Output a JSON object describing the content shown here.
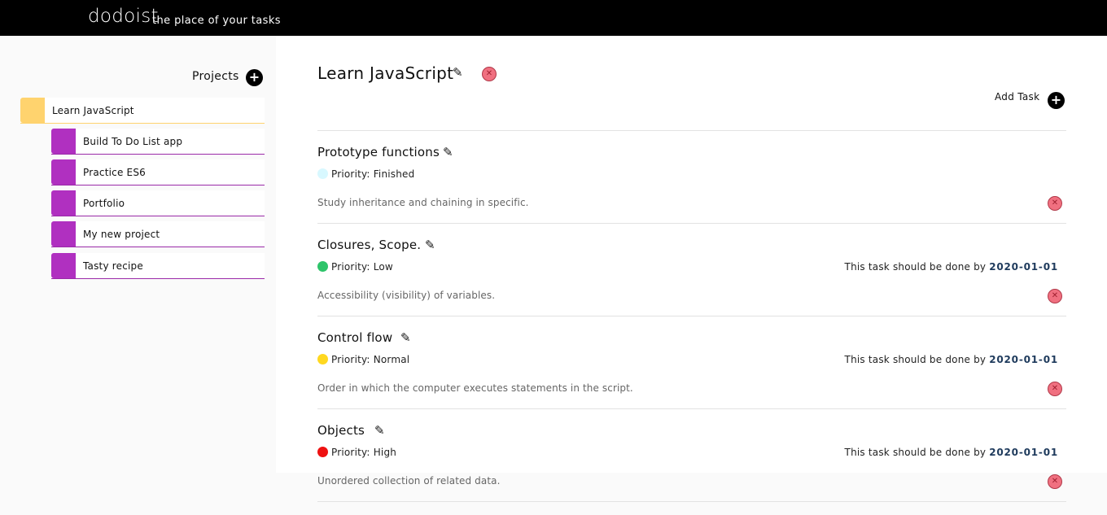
{
  "header": {
    "brand": "dodoist",
    "tagline": "the place of your tasks"
  },
  "sidebar": {
    "title": "Projects",
    "add_icon": "plus-circle-icon",
    "projects": [
      {
        "label": "Learn JavaScript",
        "color": "#ffd36e",
        "line": "#ffd36e",
        "active": true
      },
      {
        "label": "Build To Do List app",
        "color": "#b030c0",
        "line": "#9a2aa8"
      },
      {
        "label": "Practice ES6",
        "color": "#b030c0",
        "line": "#9a2aa8"
      },
      {
        "label": "Portfolio",
        "color": "#b030c0",
        "line": "#9a2aa8"
      },
      {
        "label": "My new project",
        "color": "#b030c0",
        "line": "#9a2aa8"
      },
      {
        "label": "Tasty recipe",
        "color": "#b030c0",
        "line": "#9a2aa8"
      }
    ]
  },
  "main": {
    "title": "Learn JavaScript",
    "add_task_label": "Add Task",
    "tasks": [
      {
        "title": "Prototype functions",
        "priority": "Priority: Finished",
        "dot": "#d8f8ff",
        "due_prefix": "",
        "due_date": "",
        "desc": "Study inheritance and chaining in specific."
      },
      {
        "title": "Closures, Scope.",
        "priority": "Priority: Low",
        "dot": "#2ec46a",
        "due_prefix": "This task should be done by",
        "due_date": "2020-01-01",
        "desc": "Accessibility (visibility) of variables."
      },
      {
        "title": "Control flow",
        "priority": "Priority: Normal",
        "dot": "#ffd820",
        "due_prefix": "This task should be done by",
        "due_date": "2020-01-01",
        "desc": "Order in which the computer executes statements in the script."
      },
      {
        "title": "Objects",
        "priority": "Priority: High",
        "dot": "#ee1111",
        "due_prefix": "This task should be done by",
        "due_date": "2020-01-01",
        "desc": "Unordered collection of related data."
      }
    ]
  }
}
